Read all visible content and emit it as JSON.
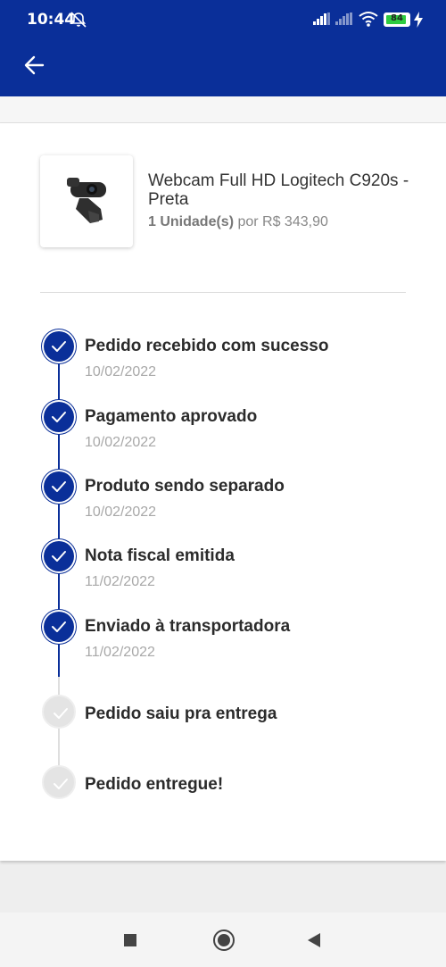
{
  "status_bar": {
    "time": "10:44",
    "battery": "84"
  },
  "product": {
    "name": "Webcam Full HD Logitech C920s - Preta",
    "quantity": "1 Unidade(s)",
    "price_prefix": " por ",
    "price": "R$ 343,90"
  },
  "steps": [
    {
      "title": "Pedido recebido com sucesso",
      "date": "10/02/2022",
      "done": true
    },
    {
      "title": "Pagamento aprovado",
      "date": "10/02/2022",
      "done": true
    },
    {
      "title": "Produto sendo separado",
      "date": "10/02/2022",
      "done": true
    },
    {
      "title": "Nota fiscal emitida",
      "date": "11/02/2022",
      "done": true
    },
    {
      "title": "Enviado à transportadora",
      "date": "11/02/2022",
      "done": true
    },
    {
      "title": "Pedido saiu pra entrega",
      "date": "",
      "done": false
    },
    {
      "title": "Pedido entregue!",
      "date": "",
      "done": false
    }
  ],
  "colors": {
    "primary": "#0a2f99",
    "pending": "#e4e4e4"
  },
  "icons": {
    "back": "arrow-left-icon",
    "check": "check-icon"
  }
}
